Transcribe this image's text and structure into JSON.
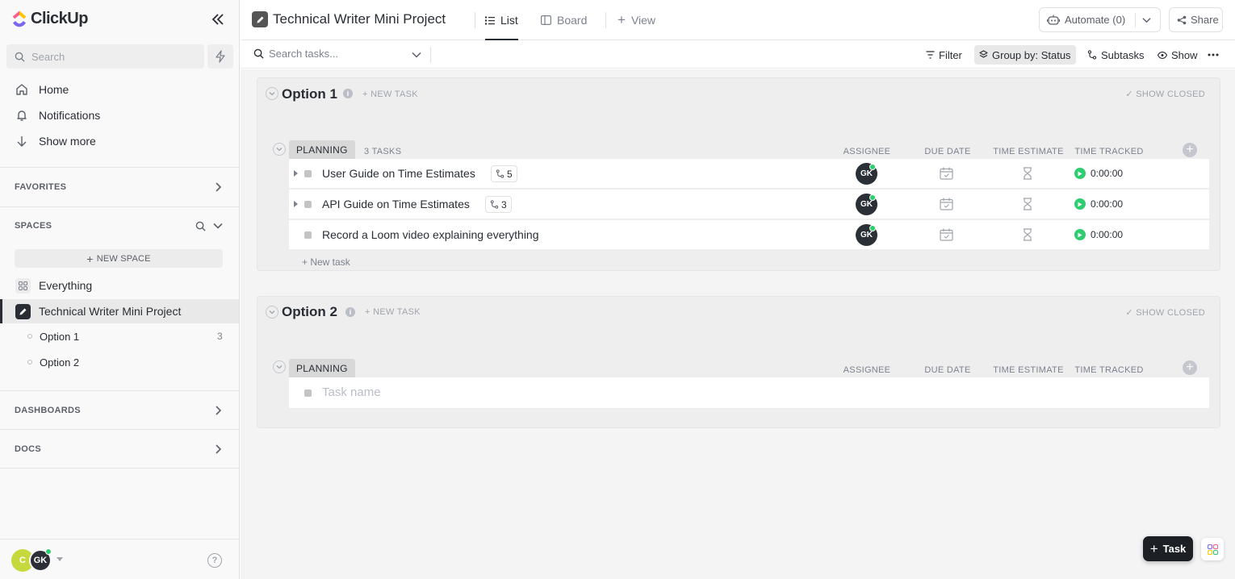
{
  "app": {
    "name": "ClickUp"
  },
  "sidebar": {
    "search_placeholder": "Search",
    "nav": [
      {
        "label": "Home",
        "icon": "home-icon"
      },
      {
        "label": "Notifications",
        "icon": "bell-icon"
      },
      {
        "label": "Show more",
        "icon": "arrow-down-icon"
      }
    ],
    "favorites_label": "FAVORITES",
    "spaces_label": "SPACES",
    "new_space_label": "NEW SPACE",
    "spaces": [
      {
        "label": "Everything",
        "icon": "grid-icon",
        "active": false
      },
      {
        "label": "Technical Writer Mini Project",
        "icon": "pencil-icon",
        "active": true
      }
    ],
    "lists": [
      {
        "label": "Option 1",
        "count": "3"
      },
      {
        "label": "Option 2",
        "count": ""
      }
    ],
    "dashboards_label": "DASHBOARDS",
    "docs_label": "DOCS",
    "user": {
      "avatar1": "C",
      "avatar2": "GK"
    }
  },
  "header": {
    "project_title": "Technical Writer Mini Project",
    "tabs": [
      {
        "label": "List",
        "active": true
      },
      {
        "label": "Board",
        "active": false
      },
      {
        "label": "View",
        "active": false
      }
    ],
    "automate_label": "Automate (0)",
    "share_label": "Share"
  },
  "toolbar": {
    "search_placeholder": "Search tasks...",
    "filter_label": "Filter",
    "group_by_label": "Group by: Status",
    "subtasks_label": "Subtasks",
    "show_label": "Show"
  },
  "columns": {
    "assignee": "ASSIGNEE",
    "due_date": "DUE DATE",
    "time_estimate": "TIME ESTIMATE",
    "time_tracked": "TIME TRACKED"
  },
  "groups": [
    {
      "title": "Option 1",
      "new_task_label": "+ NEW TASK",
      "show_closed_label": "SHOW CLOSED",
      "status": "PLANNING",
      "task_count": "3 TASKS",
      "tasks": [
        {
          "name": "User Guide on Time Estimates",
          "subtasks": "5",
          "assignee": "GK",
          "tracked": "0:00:00"
        },
        {
          "name": "API Guide on Time Estimates",
          "subtasks": "3",
          "assignee": "GK",
          "tracked": "0:00:00"
        },
        {
          "name": "Record a Loom video explaining everything",
          "subtasks": "",
          "assignee": "GK",
          "tracked": "0:00:00"
        }
      ],
      "add_task_label": "+ New task"
    },
    {
      "title": "Option 2",
      "new_task_label": "+ NEW TASK",
      "show_closed_label": "SHOW CLOSED",
      "status": "PLANNING",
      "task_name_placeholder": "Task name"
    }
  ],
  "fab": {
    "task_label": "Task"
  },
  "colors": {
    "accent_dark": "#292d34",
    "online_green": "#2ecd6f",
    "timer_green": "#2ecd6f",
    "avatar_c": "#c5d93c"
  }
}
